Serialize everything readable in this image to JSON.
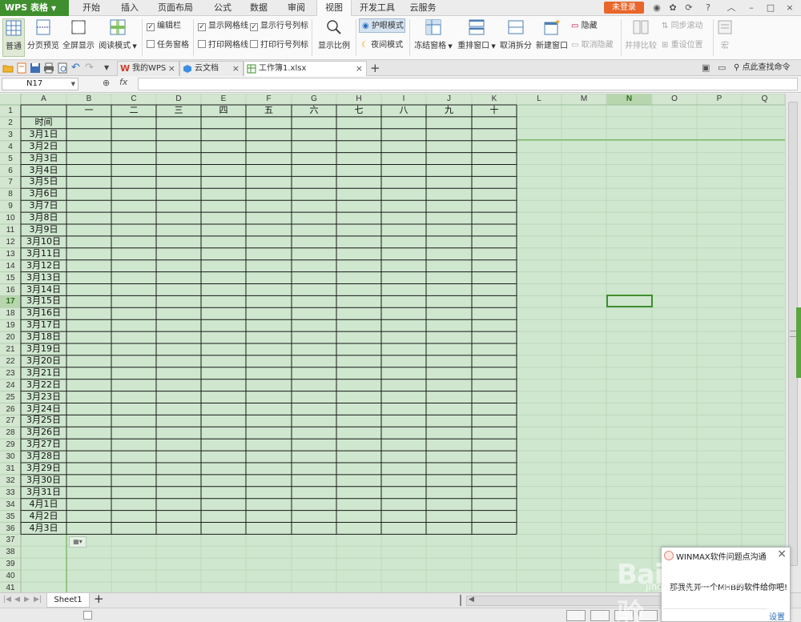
{
  "app": {
    "logo": "WPS 表格",
    "menu_tabs": [
      "开始",
      "插入",
      "页面布局",
      "公式",
      "数据",
      "审阅",
      "视图",
      "开发工具",
      "云服务"
    ],
    "active_tab": "视图",
    "login": "未登录",
    "window_controls": [
      "?",
      "–",
      "□",
      "×"
    ]
  },
  "ribbon": {
    "big_buttons": {
      "normal": "普通",
      "page_break": "分页预览",
      "fullscreen": "全屏显示",
      "read_mode": "阅读模式",
      "zoom": "显示比例",
      "freeze": "冻结窗格",
      "arrange": "重排窗口",
      "unsplit": "取消拆分",
      "new_window": "新建窗口",
      "side_by_side": "并排比较",
      "macro": "宏"
    },
    "checkboxes": {
      "edit_bar": "编辑栏",
      "task_pane": "任务窗格",
      "show_gridlines": "显示网格线",
      "print_gridlines": "打印网格线",
      "show_headings": "显示行号列标",
      "print_headings": "打印行号列标"
    },
    "small": {
      "eye_mode": "护眼模式",
      "night_mode": "夜间模式",
      "hide": "隐藏",
      "unhide": "取消隐藏",
      "sync_scroll": "同步滚动",
      "reset_position": "重设位置"
    }
  },
  "doc_tabs": {
    "my_wps": "我的WPS",
    "cloud_docs": "云文档",
    "workbook": "工作簿1.xlsx",
    "search_command": "点此查找命令"
  },
  "formula_bar": {
    "name_box": "N17",
    "fx": "fx",
    "formula": ""
  },
  "sheet": {
    "columns": [
      "A",
      "B",
      "C",
      "D",
      "E",
      "F",
      "G",
      "H",
      "I",
      "J",
      "K",
      "L",
      "M",
      "N",
      "O",
      "P",
      "Q"
    ],
    "selected_cell": "N17",
    "header_row": [
      "",
      "一",
      "二",
      "三",
      "四",
      "五",
      "六",
      "七",
      "八",
      "九",
      "十"
    ],
    "a2": "时间",
    "dates": [
      "3月1日",
      "3月2日",
      "3月3日",
      "3月4日",
      "3月5日",
      "3月6日",
      "3月7日",
      "3月8日",
      "3月9日",
      "3月10日",
      "3月11日",
      "3月12日",
      "3月13日",
      "3月14日",
      "3月15日",
      "3月16日",
      "3月17日",
      "3月18日",
      "3月19日",
      "3月20日",
      "3月21日",
      "3月22日",
      "3月23日",
      "3月24日",
      "3月25日",
      "3月26日",
      "3月27日",
      "3月28日",
      "3月29日",
      "3月30日",
      "3月31日",
      "4月1日",
      "4月2日",
      "4月3日"
    ],
    "row_count": 41,
    "tab_name": "Sheet1"
  },
  "popup": {
    "title": "WINMAX软件问题点沟通",
    "message": "那我先弄一个MHB的软件给你吧!",
    "setting": "设置"
  },
  "watermark": {
    "brand": "Bai du 经验",
    "url": "jingyan.baidu.com"
  },
  "colors": {
    "sheet_bg": "#cfe7cf",
    "accent": "#3f8f2f",
    "login": "#e8662a"
  }
}
